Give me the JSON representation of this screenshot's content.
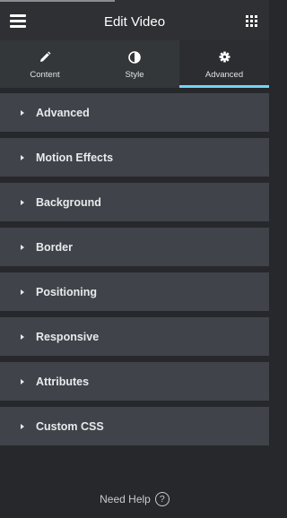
{
  "header": {
    "title": "Edit Video"
  },
  "tabs": [
    {
      "label": "Content",
      "icon": "pencil-icon"
    },
    {
      "label": "Style",
      "icon": "half-circle-icon"
    },
    {
      "label": "Advanced",
      "icon": "gear-icon",
      "active": true
    }
  ],
  "sections": [
    {
      "label": "Advanced"
    },
    {
      "label": "Motion Effects"
    },
    {
      "label": "Background"
    },
    {
      "label": "Border"
    },
    {
      "label": "Positioning"
    },
    {
      "label": "Responsive"
    },
    {
      "label": "Attributes"
    },
    {
      "label": "Custom CSS"
    }
  ],
  "help": {
    "label": "Need Help",
    "icon_text": "?"
  },
  "colors": {
    "accent": "#71d7f7",
    "panel": "#26282b",
    "section": "#404349"
  }
}
